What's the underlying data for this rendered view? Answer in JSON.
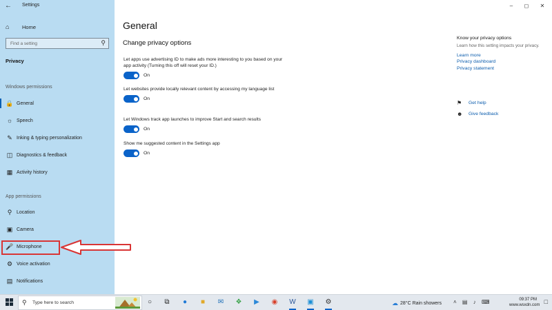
{
  "window": {
    "title": "Settings"
  },
  "sidebar": {
    "home_label": "Home",
    "search_placeholder": "Find a setting",
    "section": "Privacy",
    "group_windows": "Windows permissions",
    "group_app": "App permissions",
    "windows_items": [
      {
        "label": "General",
        "icon": "lock-icon"
      },
      {
        "label": "Speech",
        "icon": "speech-icon"
      },
      {
        "label": "Inking & typing personalization",
        "icon": "inking-icon"
      },
      {
        "label": "Diagnostics & feedback",
        "icon": "diagnostics-icon"
      },
      {
        "label": "Activity history",
        "icon": "activity-icon"
      }
    ],
    "app_items": [
      {
        "label": "Location",
        "icon": "location-icon"
      },
      {
        "label": "Camera",
        "icon": "camera-icon"
      },
      {
        "label": "Microphone",
        "icon": "microphone-icon"
      },
      {
        "label": "Voice activation",
        "icon": "voice-icon"
      },
      {
        "label": "Notifications",
        "icon": "notifications-icon"
      }
    ]
  },
  "main": {
    "title": "General",
    "subtitle": "Change privacy options",
    "settings": [
      {
        "desc": "Let apps use advertising ID to make ads more interesting to you based on your app activity (Turning this off will reset your ID.)",
        "state": "On"
      },
      {
        "desc": "Let websites provide locally relevant content by accessing my language list",
        "state": "On"
      },
      {
        "desc": "Let Windows track app launches to improve Start and search results",
        "state": "On"
      },
      {
        "desc": "Show me suggested content in the Settings app",
        "state": "On"
      }
    ]
  },
  "right_panel": {
    "heading": "Know your privacy options",
    "text": "Learn how this setting impacts your privacy.",
    "links": [
      "Learn more",
      "Privacy dashboard",
      "Privacy statement"
    ],
    "get_help": "Get help",
    "give_feedback": "Give feedback"
  },
  "taskbar": {
    "search_placeholder": "Type here to search",
    "weather": "28°C  Rain showers",
    "time": "09:37 PM",
    "date": "www.wsxdn.com"
  },
  "colors": {
    "accent": "#0a63c9",
    "sidebar_bg": "#b9dcf2",
    "highlight": "#d93434"
  }
}
